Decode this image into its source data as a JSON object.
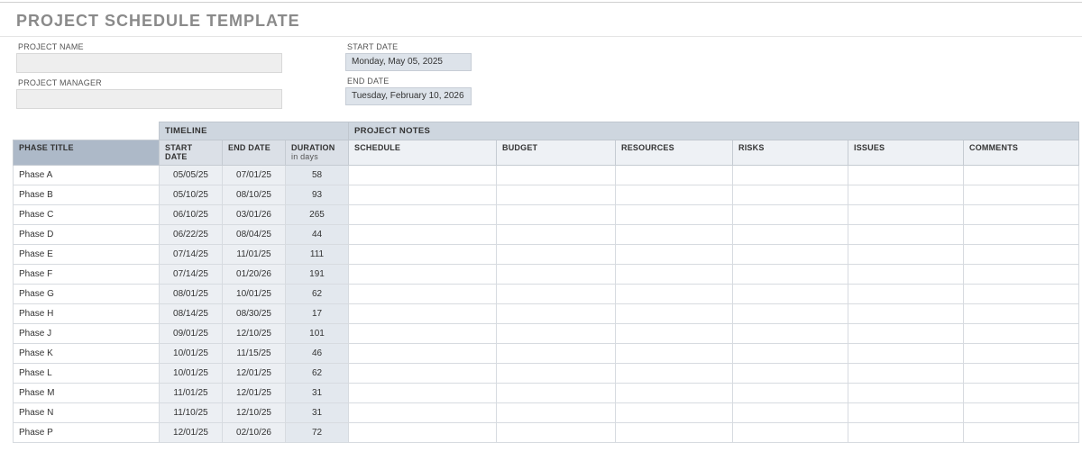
{
  "title": "PROJECT SCHEDULE TEMPLATE",
  "meta": {
    "project_name_label": "PROJECT NAME",
    "project_name_value": "",
    "project_manager_label": "PROJECT MANAGER",
    "project_manager_value": "",
    "start_date_label": "START DATE",
    "start_date_value": "Monday, May 05, 2025",
    "end_date_label": "END DATE",
    "end_date_value": "Tuesday, February 10, 2026"
  },
  "group_headers": {
    "timeline": "TIMELINE",
    "project_notes": "PROJECT NOTES"
  },
  "columns": {
    "phase_title": "PHASE TITLE",
    "start_date": "START DATE",
    "end_date": "END DATE",
    "duration": "DURATION",
    "duration_sub": "in days",
    "schedule": "SCHEDULE",
    "budget": "BUDGET",
    "resources": "RESOURCES",
    "risks": "RISKS",
    "issues": "ISSUES",
    "comments": "COMMENTS"
  },
  "rows": [
    {
      "phase": "Phase A",
      "start": "05/05/25",
      "end": "07/01/25",
      "duration": "58"
    },
    {
      "phase": "Phase B",
      "start": "05/10/25",
      "end": "08/10/25",
      "duration": "93"
    },
    {
      "phase": "Phase C",
      "start": "06/10/25",
      "end": "03/01/26",
      "duration": "265"
    },
    {
      "phase": "Phase D",
      "start": "06/22/25",
      "end": "08/04/25",
      "duration": "44"
    },
    {
      "phase": "Phase E",
      "start": "07/14/25",
      "end": "11/01/25",
      "duration": "111"
    },
    {
      "phase": "Phase F",
      "start": "07/14/25",
      "end": "01/20/26",
      "duration": "191"
    },
    {
      "phase": "Phase G",
      "start": "08/01/25",
      "end": "10/01/25",
      "duration": "62"
    },
    {
      "phase": "Phase H",
      "start": "08/14/25",
      "end": "08/30/25",
      "duration": "17"
    },
    {
      "phase": "Phase J",
      "start": "09/01/25",
      "end": "12/10/25",
      "duration": "101"
    },
    {
      "phase": "Phase K",
      "start": "10/01/25",
      "end": "11/15/25",
      "duration": "46"
    },
    {
      "phase": "Phase L",
      "start": "10/01/25",
      "end": "12/01/25",
      "duration": "62"
    },
    {
      "phase": "Phase M",
      "start": "11/01/25",
      "end": "12/01/25",
      "duration": "31"
    },
    {
      "phase": "Phase N",
      "start": "11/10/25",
      "end": "12/10/25",
      "duration": "31"
    },
    {
      "phase": "Phase P",
      "start": "12/01/25",
      "end": "02/10/26",
      "duration": "72"
    }
  ],
  "chart_data": {
    "type": "table",
    "title": "PROJECT SCHEDULE TEMPLATE",
    "columns": [
      "PHASE TITLE",
      "START DATE",
      "END DATE",
      "DURATION (days)",
      "SCHEDULE",
      "BUDGET",
      "RESOURCES",
      "RISKS",
      "ISSUES",
      "COMMENTS"
    ],
    "rows": [
      [
        "Phase A",
        "05/05/25",
        "07/01/25",
        58,
        "",
        "",
        "",
        "",
        "",
        ""
      ],
      [
        "Phase B",
        "05/10/25",
        "08/10/25",
        93,
        "",
        "",
        "",
        "",
        "",
        ""
      ],
      [
        "Phase C",
        "06/10/25",
        "03/01/26",
        265,
        "",
        "",
        "",
        "",
        "",
        ""
      ],
      [
        "Phase D",
        "06/22/25",
        "08/04/25",
        44,
        "",
        "",
        "",
        "",
        "",
        ""
      ],
      [
        "Phase E",
        "07/14/25",
        "11/01/25",
        111,
        "",
        "",
        "",
        "",
        "",
        ""
      ],
      [
        "Phase F",
        "07/14/25",
        "01/20/26",
        191,
        "",
        "",
        "",
        "",
        "",
        ""
      ],
      [
        "Phase G",
        "08/01/25",
        "10/01/25",
        62,
        "",
        "",
        "",
        "",
        "",
        ""
      ],
      [
        "Phase H",
        "08/14/25",
        "08/30/25",
        17,
        "",
        "",
        "",
        "",
        "",
        ""
      ],
      [
        "Phase J",
        "09/01/25",
        "12/10/25",
        101,
        "",
        "",
        "",
        "",
        "",
        ""
      ],
      [
        "Phase K",
        "10/01/25",
        "11/15/25",
        46,
        "",
        "",
        "",
        "",
        "",
        ""
      ],
      [
        "Phase L",
        "10/01/25",
        "12/01/25",
        62,
        "",
        "",
        "",
        "",
        "",
        ""
      ],
      [
        "Phase M",
        "11/01/25",
        "12/01/25",
        31,
        "",
        "",
        "",
        "",
        "",
        ""
      ],
      [
        "Phase N",
        "11/10/25",
        "12/10/25",
        31,
        "",
        "",
        "",
        "",
        "",
        ""
      ],
      [
        "Phase P",
        "12/01/25",
        "02/10/26",
        72,
        "",
        "",
        "",
        "",
        "",
        ""
      ]
    ]
  }
}
